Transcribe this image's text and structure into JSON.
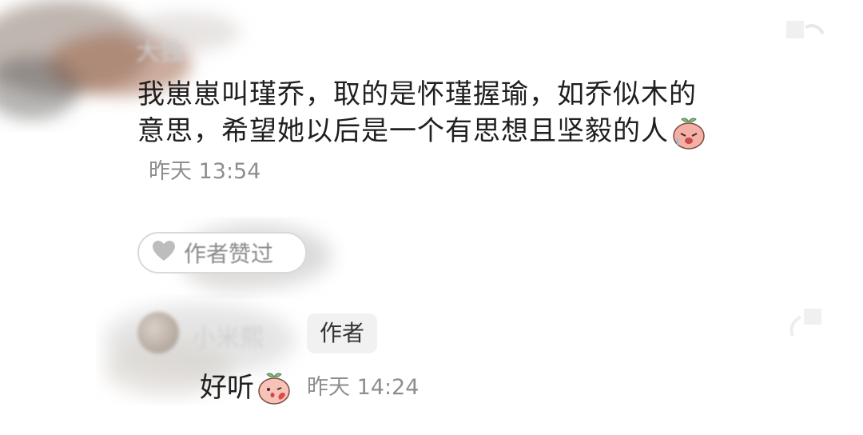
{
  "comment": {
    "author_name": "大独",
    "text": "我崽崽叫瑾乔，取的是怀瑾握瑜，如乔似木的意思，希望她以后是一个有思想且坚毅的人",
    "emoji_icon": "crying-peach-emoji-icon",
    "timestamp": "昨天 13:54",
    "liked_label": "作者赞过",
    "liked_icon": "heart-icon"
  },
  "reply": {
    "author_name": "小米熙",
    "author_badge": "作者",
    "text": "好听",
    "emoji_icon": "blushing-peach-emoji-icon",
    "timestamp": "昨天 14:24"
  }
}
